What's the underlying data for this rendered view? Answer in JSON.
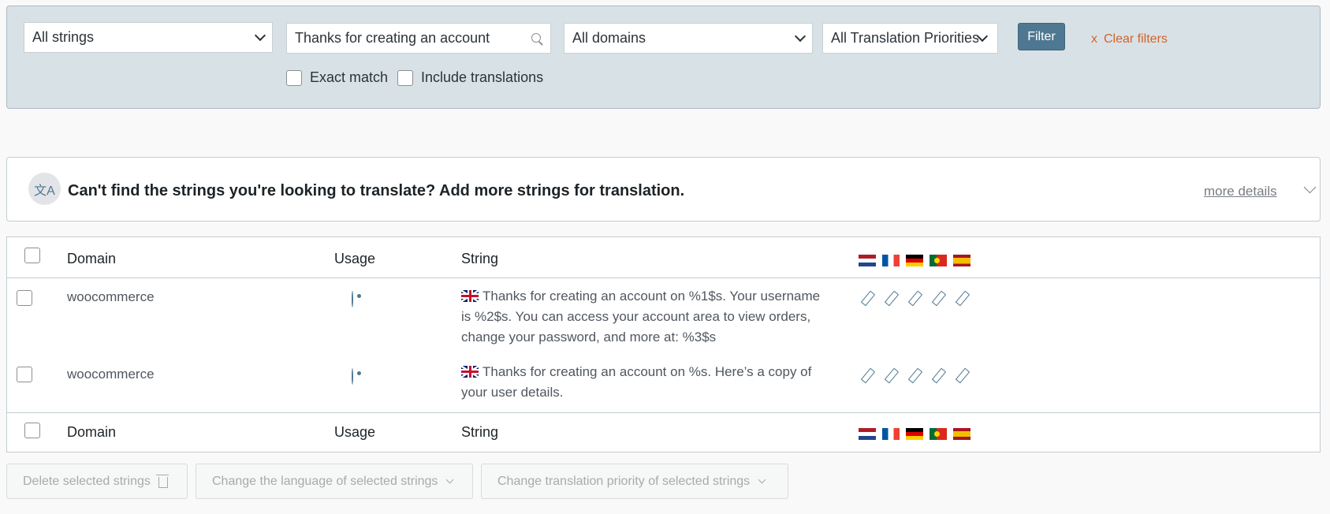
{
  "filters": {
    "string_type": "All strings",
    "search_value": "Thanks for creating an account",
    "domain": "All domains",
    "priority": "All Translation Priorities",
    "filter_button": "Filter",
    "clear_icon": "x",
    "clear_label": "Clear filters",
    "exact_match_label": "Exact match",
    "include_translations_label": "Include translations"
  },
  "notice": {
    "icon": "translate-icon",
    "icon_glyph": "文A",
    "message": "Can't find the strings you're looking to translate? Add more strings for translation.",
    "more_details": "more details"
  },
  "table": {
    "headers": {
      "domain": "Domain",
      "usage": "Usage",
      "string": "String"
    },
    "language_flags": [
      "nl",
      "fr",
      "de",
      "pt",
      "es"
    ],
    "rows": [
      {
        "domain": "woocommerce",
        "source_flag": "en",
        "string": "Thanks for creating an account on %1$s. Your username is %2$s. You can access your account area to view orders, change your password, and more at: %3$s"
      },
      {
        "domain": "woocommerce",
        "source_flag": "en",
        "string": "Thanks for creating an account on %s. Here’s a copy of your user details."
      }
    ]
  },
  "bulk_actions": {
    "delete": "Delete selected strings",
    "change_language": "Change the language of selected strings",
    "change_priority": "Change translation priority of selected strings"
  },
  "colors": {
    "accent": "#4e7891",
    "clear_link": "#d2622a",
    "filter_bg": "#d8e2e6"
  }
}
